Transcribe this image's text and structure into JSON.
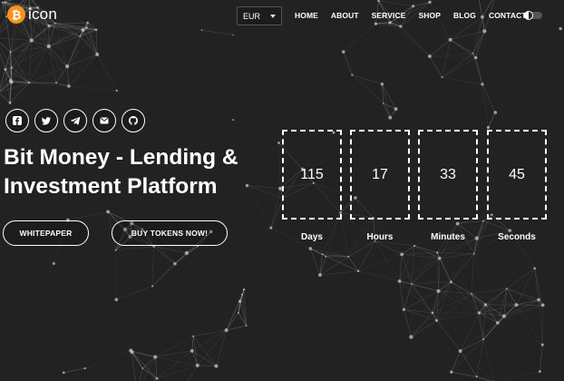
{
  "brand": {
    "badge": "₿",
    "name": "icon"
  },
  "currency": {
    "selected": "EUR"
  },
  "nav": [
    "HOME",
    "ABOUT",
    "SERVICE",
    "SHOP",
    "BLOG",
    "CONTACT"
  ],
  "social": [
    "facebook-icon",
    "twitter-icon",
    "telegram-icon",
    "email-icon",
    "github-icon"
  ],
  "hero": {
    "title": "Bit Money - Lending & Investment Platform",
    "whitepaper_label": "WHITEPAPER",
    "buy_label": "BUY TOKENS NOW!"
  },
  "countdown": [
    {
      "value": "115",
      "label": "Days"
    },
    {
      "value": "17",
      "label": "Hours"
    },
    {
      "value": "33",
      "label": "Minutes"
    },
    {
      "value": "45",
      "label": "Seconds"
    }
  ],
  "colors": {
    "background": "#222222",
    "brand": "#f7931a",
    "text": "#ffffff"
  }
}
